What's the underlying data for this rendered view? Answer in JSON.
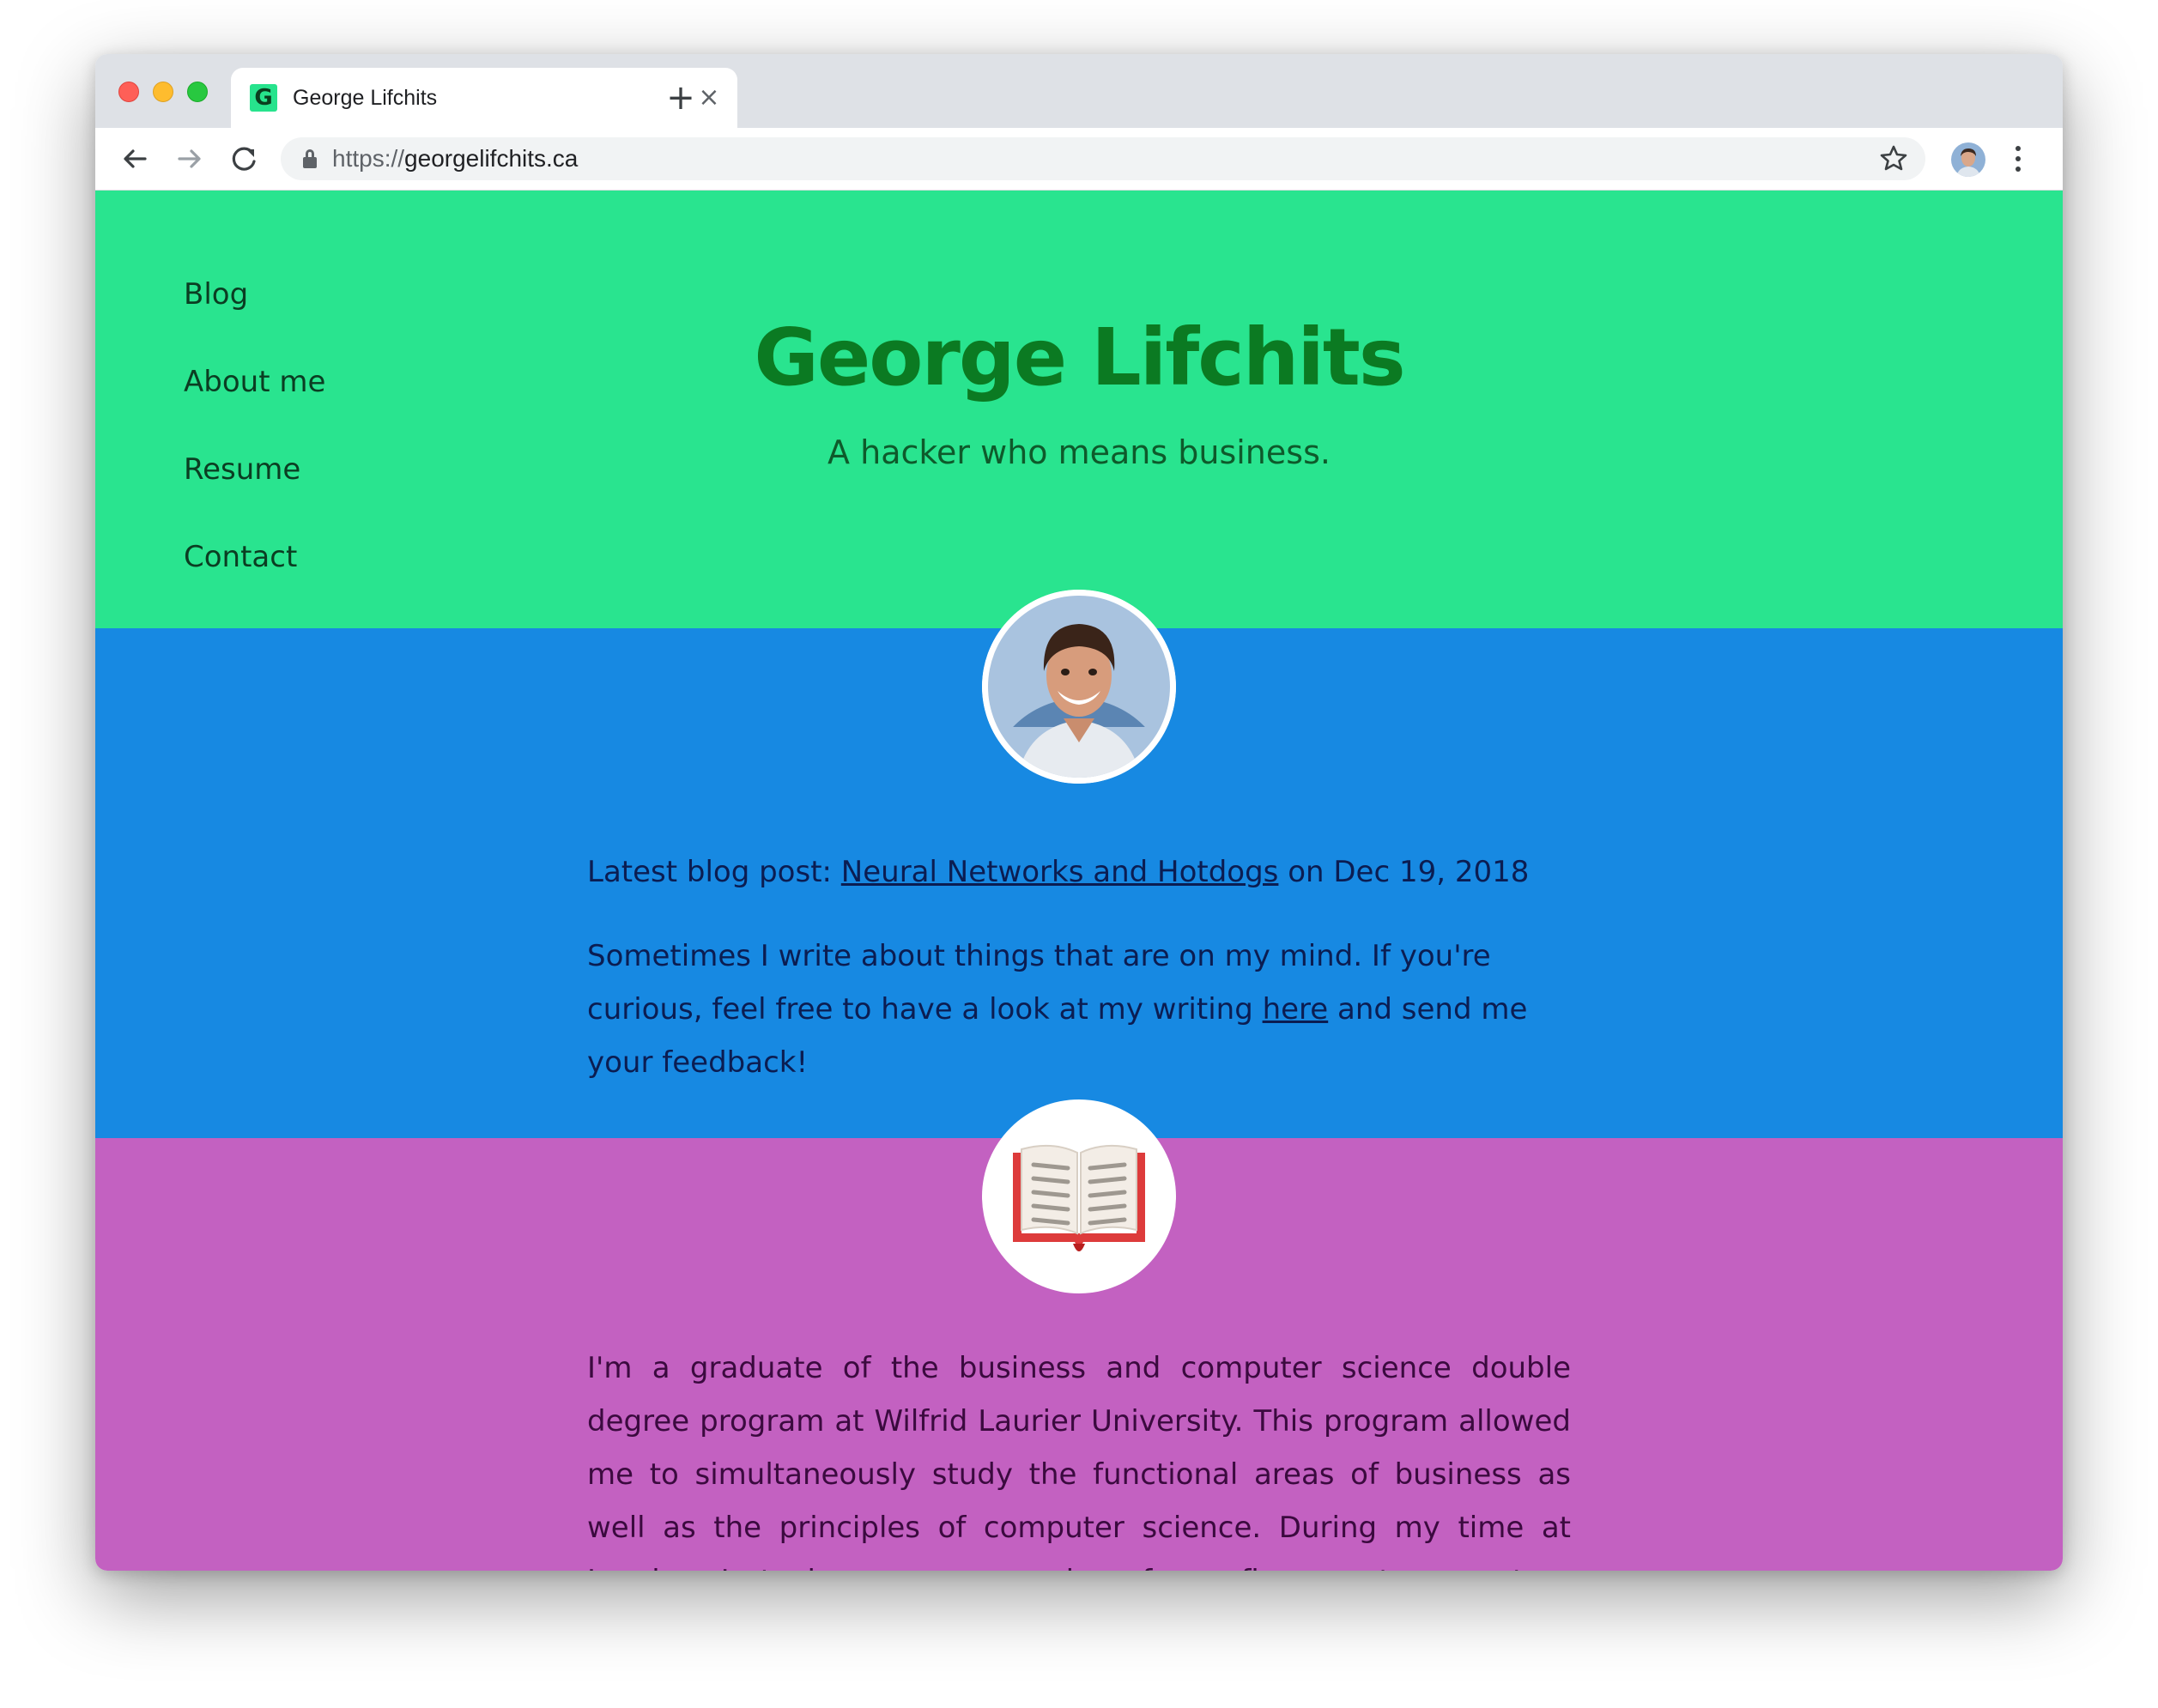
{
  "browser": {
    "tab_title": "George Lifchits",
    "favicon_letter": "G",
    "favicon_color": "#27e38d",
    "close_glyph": "×",
    "new_tab_glyph": "+",
    "url_scheme": "https://",
    "url_host": "georgelifchits.ca",
    "icons": [
      "back-arrow-icon",
      "forward-arrow-icon",
      "reload-icon",
      "lock-icon",
      "star-icon",
      "profile-avatar",
      "more-menu-icon"
    ]
  },
  "nav": {
    "items": [
      "Blog",
      "About me",
      "Resume",
      "Contact"
    ]
  },
  "header": {
    "title": "George Lifchits",
    "tagline": "A hacker who means business."
  },
  "blog": {
    "prefix": "Latest blog post: ",
    "post_title": "Neural Networks and Hotdogs",
    "date_text": " on Dec 19, 2018",
    "writing_before": "Sometimes I write about things that are on my mind. If you're curious, feel free to have a look at my writing ",
    "writing_link": "here",
    "writing_after": " and send me your feedback!"
  },
  "about": {
    "text": "I'm a graduate of the business and computer science double degree program at Wilfrid Laurier University. This program allowed me to simultaneously study the functional areas of business as well as the principles of computer science. During my time at Laurier I took courses ranging from finance to quantum computing, travelled the world with the debating team, slugged back many litres of black Starbucks blonde roast"
  },
  "colors": {
    "green_band": "#29e48f",
    "blue_band": "#1789e2",
    "purple_band": "#c361c1",
    "title_green": "#0b7a22"
  }
}
